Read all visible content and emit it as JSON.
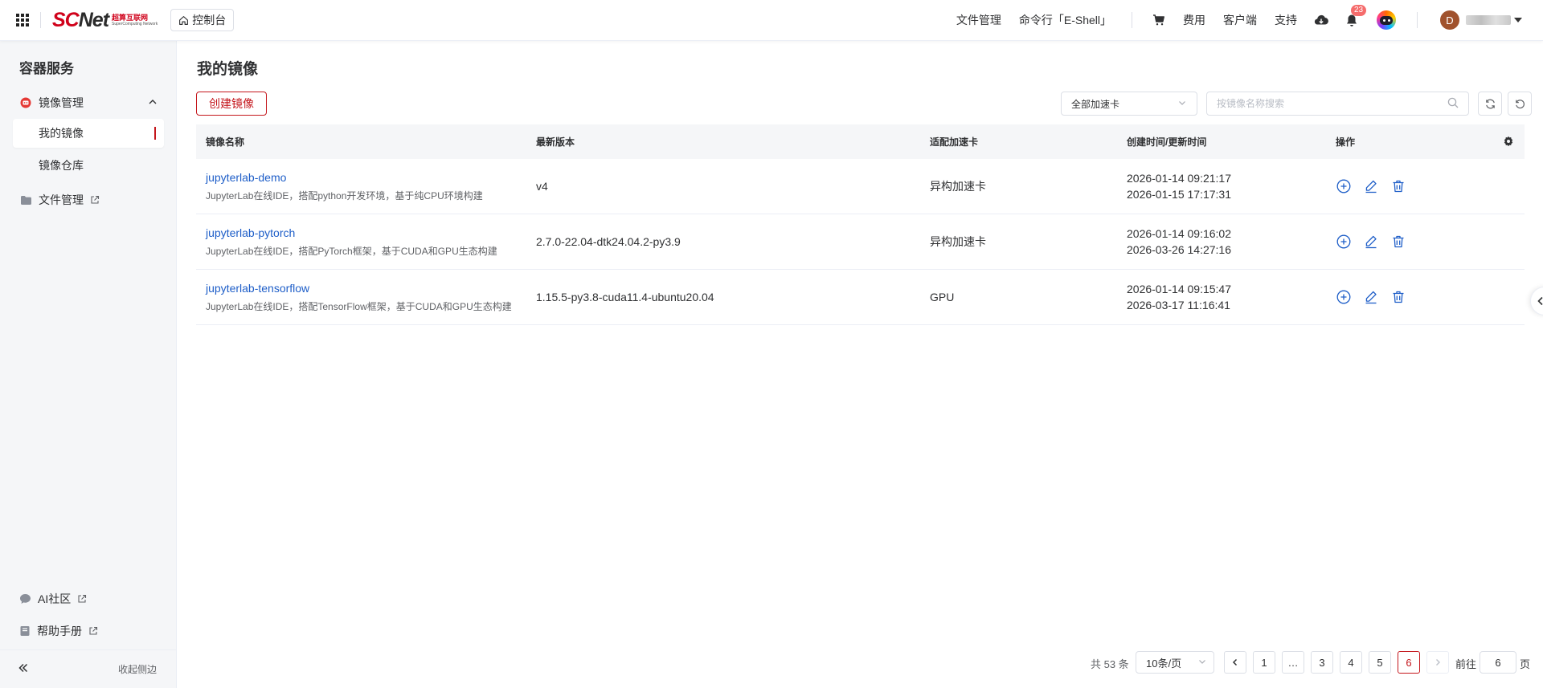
{
  "header": {
    "logo_main": "SC",
    "logo_net": "Net",
    "logo_cn": "超算互联网",
    "logo_en": "SuperComputing Network",
    "console_label": "控制台",
    "links": [
      "文件管理",
      "命令行「E-Shell」",
      "费用",
      "客户端",
      "支持"
    ],
    "notification_count": "23",
    "user_initial": "D"
  },
  "sidebar": {
    "title": "容器服务",
    "group_image": "镜像管理",
    "item_my_images": "我的镜像",
    "item_repository": "镜像仓库",
    "group_files": "文件管理",
    "ai_community": "AI社区",
    "help_manual": "帮助手册",
    "collapse_label": "收起侧边"
  },
  "main": {
    "title": "我的镜像",
    "create_button": "创建镜像",
    "filter_select": "全部加速卡",
    "search_placeholder": "按镜像名称搜索",
    "columns": [
      "镜像名称",
      "最新版本",
      "适配加速卡",
      "创建时间/更新时间",
      "操作"
    ],
    "rows": [
      {
        "name": "jupyterlab-demo",
        "desc": "JupyterLab在线IDE，搭配python开发环境，基于纯CPU环境构建",
        "version": "v4",
        "card": "异构加速卡",
        "created": "2026-01-14 09:21:17",
        "updated": "2026-01-15 17:17:31"
      },
      {
        "name": "jupyterlab-pytorch",
        "desc": "JupyterLab在线IDE，搭配PyTorch框架，基于CUDA和GPU生态构建",
        "version": "2.7.0-22.04-dtk24.04.2-py3.9",
        "card": "异构加速卡",
        "created": "2026-01-14 09:16:02",
        "updated": "2026-03-26 14:27:16"
      },
      {
        "name": "jupyterlab-tensorflow",
        "desc": "JupyterLab在线IDE，搭配TensorFlow框架，基于CUDA和GPU生态构建",
        "version": "1.15.5-py3.8-cuda11.4-ubuntu20.04",
        "card": "GPU",
        "created": "2026-01-14 09:15:47",
        "updated": "2026-03-17 11:16:41"
      }
    ]
  },
  "pagination": {
    "total": "共 53 条",
    "page_size": "10条/页",
    "pages": [
      "1",
      "…",
      "3",
      "4",
      "5",
      "6"
    ],
    "current": "6",
    "goto_prefix": "前往",
    "goto_value": "6",
    "goto_suffix": "页"
  },
  "colors": {
    "brand_red": "#c4161c",
    "link_blue": "#1e5ec8",
    "sidebar_bg": "#f5f6f8"
  }
}
